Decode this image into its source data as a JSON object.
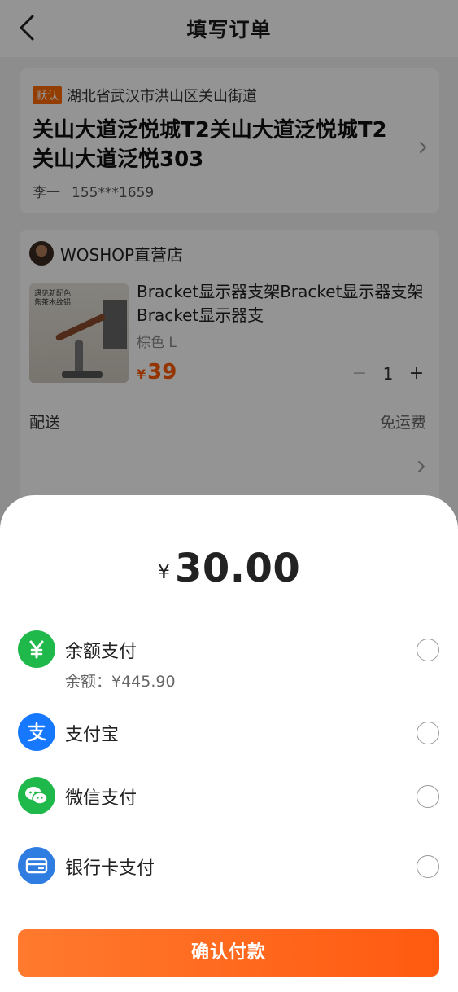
{
  "header": {
    "title": "填写订单"
  },
  "address": {
    "badge": "默认",
    "region": "湖北省武汉市洪山区关山街道",
    "detail": "关山大道泛悦城T2关山大道泛悦城T2关山大道泛悦303",
    "name": "李一",
    "phone": "155***1659"
  },
  "order": {
    "shop_name": "WOSHOP直营店",
    "product": {
      "image_caption_1": "遇见新配色",
      "image_caption_2": "焦茶木纹铝",
      "title": "Bracket显示器支架Bracket显示器支架Bracket显示器支",
      "spec": "棕色 L",
      "currency": "¥",
      "price": "39",
      "minus": "−",
      "quantity": "1",
      "plus": "+"
    },
    "delivery_label": "配送",
    "delivery_value": "免运费"
  },
  "payment": {
    "currency": "¥",
    "amount": "30.00",
    "options": [
      {
        "label": "余额支付",
        "icon": "yen-icon",
        "color": "#1fb84a"
      },
      {
        "label": "支付宝",
        "icon": "alipay-icon",
        "color": "#1677ff"
      },
      {
        "label": "微信支付",
        "icon": "wechat-icon",
        "color": "#1fb84a"
      },
      {
        "label": "银行卡支付",
        "icon": "bank-card-icon",
        "color": "#2f7de1"
      }
    ],
    "balance_note": "余额：¥445.90",
    "confirm_label": "确认付款"
  }
}
